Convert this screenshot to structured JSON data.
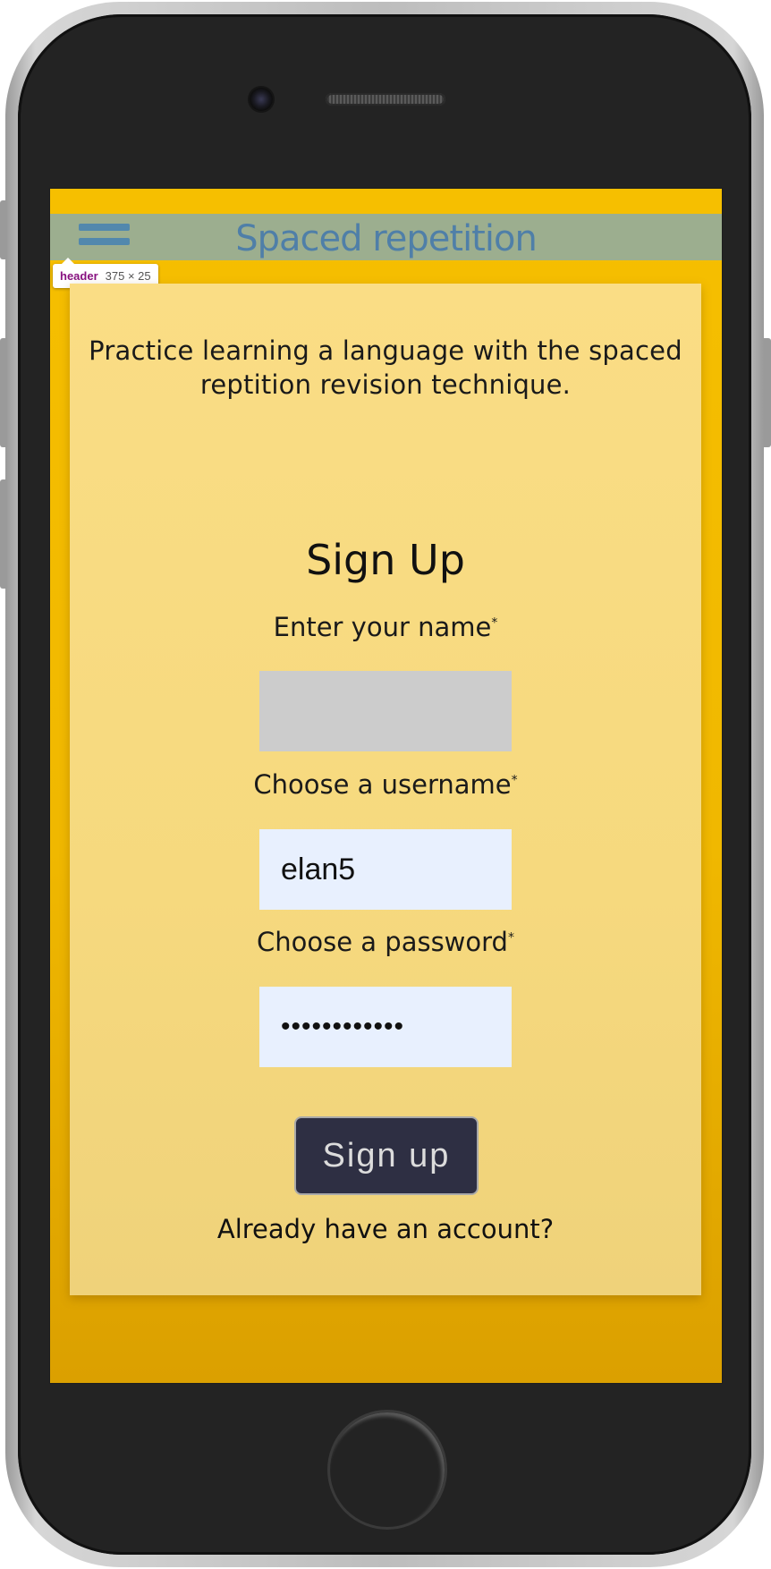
{
  "header": {
    "title": "Spaced repetition",
    "menu_icon": "hamburger-menu-icon"
  },
  "devtools_tooltip": {
    "tag": "header",
    "dims": "375 × 25"
  },
  "intro": {
    "text": "Practice learning a language with the spaced reptition revision technique."
  },
  "form": {
    "title": "Sign Up",
    "name_label": "Enter your name",
    "name_value": "",
    "username_label": "Choose a username",
    "username_value": "elan5",
    "password_label": "Choose a password",
    "password_value": "••••••••••••",
    "required_marker": "*",
    "submit_label": "Sign up",
    "login_link": "Already have an account?"
  },
  "colors": {
    "background": "#f6bf00",
    "header": "#9cae8f",
    "title": "#4f7fa8",
    "card": "#fadd85",
    "button": "#2e2f43"
  }
}
